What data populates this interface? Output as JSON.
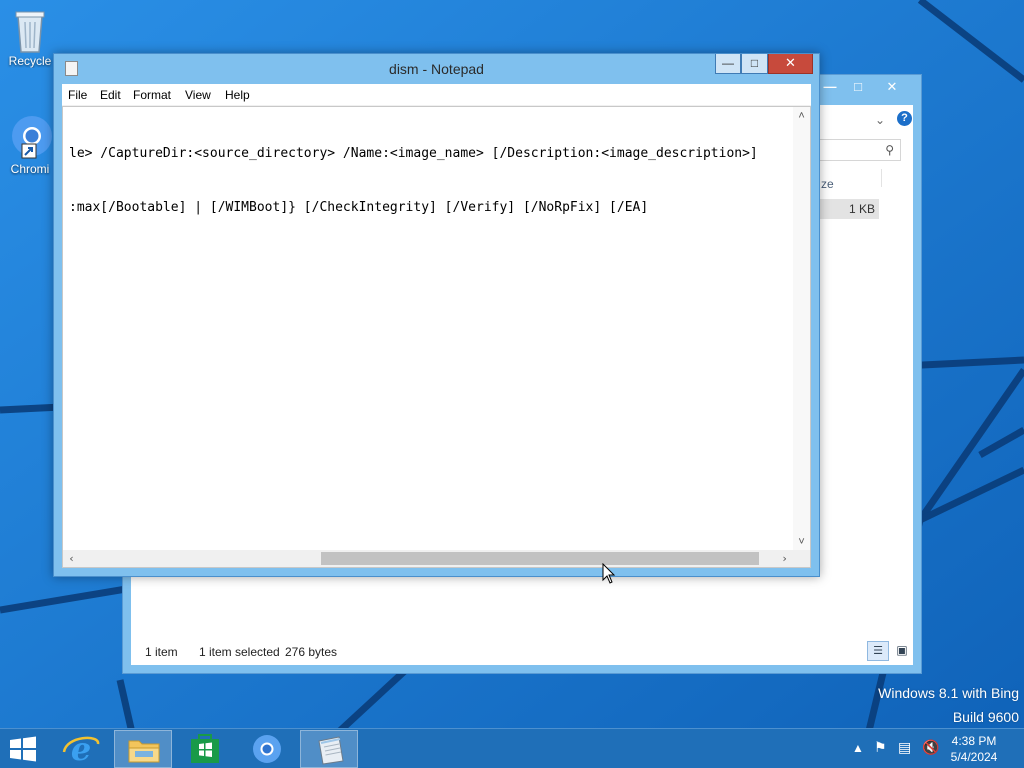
{
  "desktop": {
    "icons": [
      {
        "label": "Recycle",
        "icon": "recycle-bin-icon"
      },
      {
        "label": "Chromi",
        "icon": "chromium-icon"
      }
    ],
    "watermark": {
      "line1": "Windows 8.1 with Bing",
      "line2": "Build 9600"
    }
  },
  "explorer": {
    "size_col": "ze",
    "file_size": "1 KB",
    "status": {
      "items": "1 item",
      "selected": "1 item selected",
      "bytes": "276 bytes"
    }
  },
  "notepad": {
    "title": "dism - Notepad",
    "menu": [
      "File",
      "Edit",
      "Format",
      "View",
      "Help"
    ],
    "content": {
      "line1": "le> /CaptureDir:<source_directory> /Name:<image_name> [/Description:<image_description>]",
      "line2": ":max[/Bootable] | [/WIMBoot]} [/CheckIntegrity] [/Verify] [/NoRpFix] [/EA]"
    },
    "hscroll_position": 0.58
  },
  "taskbar": {
    "apps": [
      {
        "name": "internet-explorer",
        "active": false
      },
      {
        "name": "file-explorer",
        "active": true
      },
      {
        "name": "store",
        "active": false
      },
      {
        "name": "chromium",
        "active": false
      },
      {
        "name": "notepad",
        "active": true
      }
    ],
    "clock": {
      "time": "4:38 PM",
      "date": "5/4/2024"
    }
  },
  "colors": {
    "desktop_blue": "#1e7fd6",
    "accent": "#7fc0ee",
    "close_red": "#c74a3c"
  }
}
